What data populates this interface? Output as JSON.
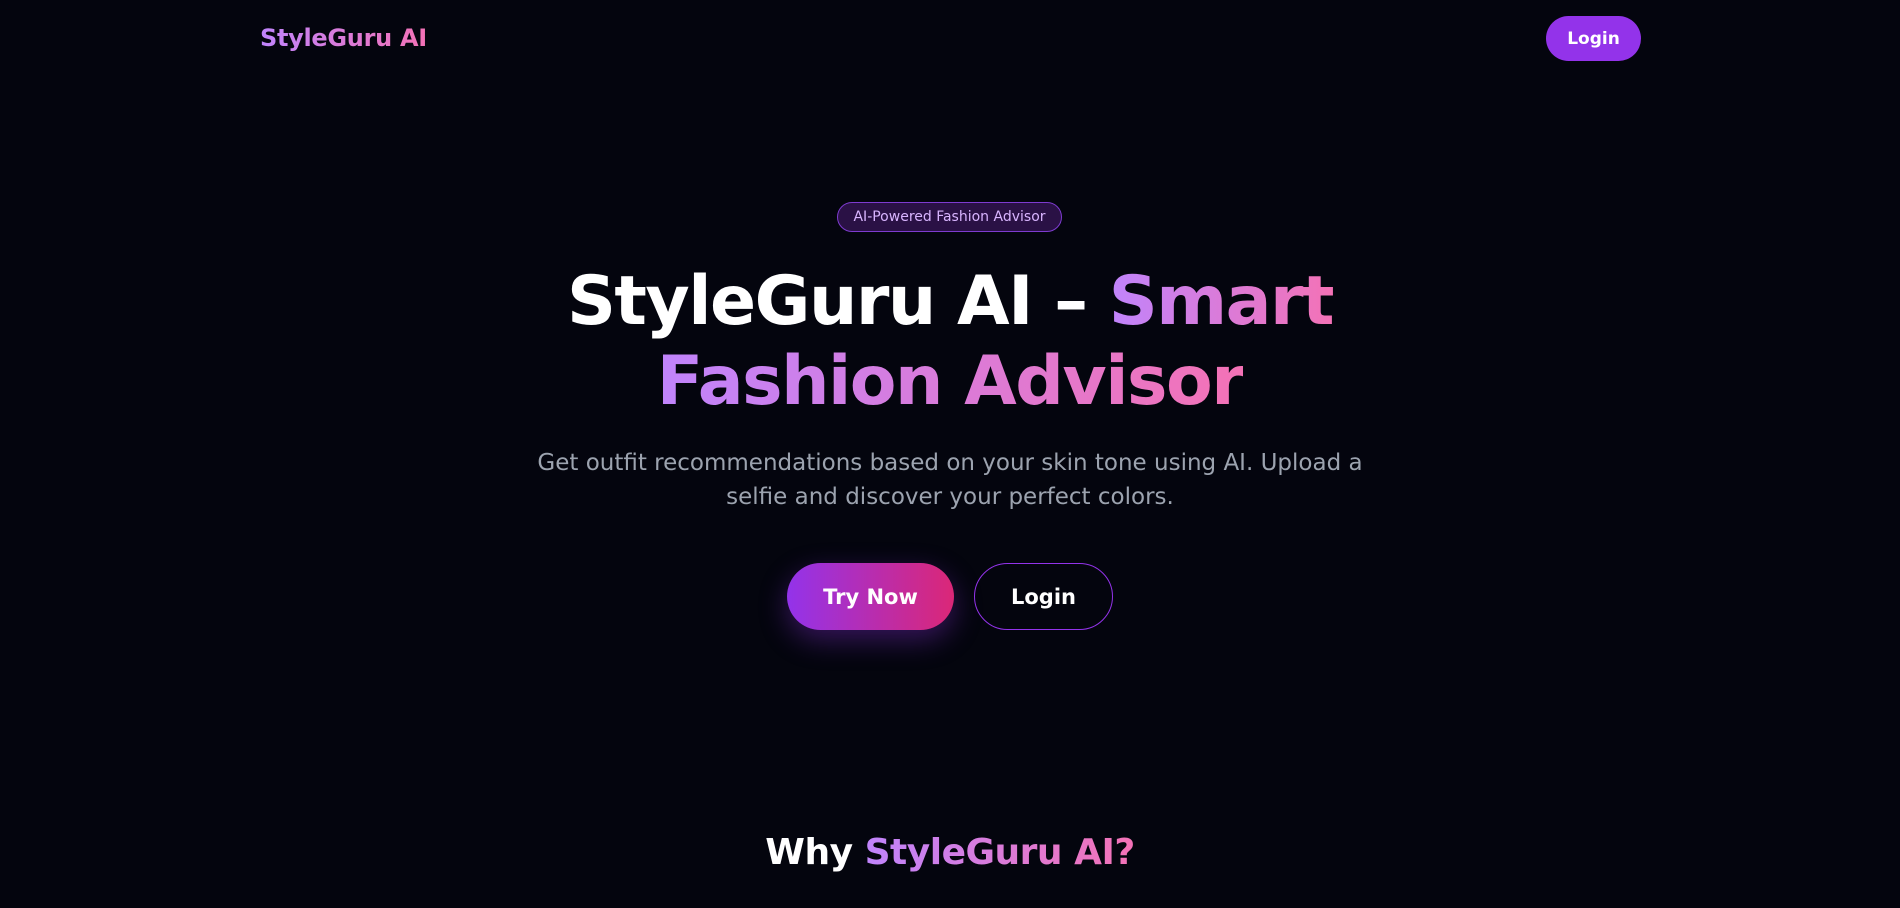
{
  "navbar": {
    "brand": "StyleGuru AI",
    "login_label": "Login"
  },
  "hero": {
    "badge": "AI-Powered Fashion Advisor",
    "headline_plain": "StyleGuru AI – ",
    "headline_accent_1": "Smart",
    "headline_accent_2": "Fashion Advisor",
    "subtitle": "Get outfit recommendations based on your skin tone using AI. Upload a selfie and discover your perfect colors.",
    "try_label": "Try Now",
    "login_label": "Login"
  },
  "why": {
    "prefix": "Why ",
    "accent": "StyleGuru AI?"
  },
  "colors": {
    "background": "#04050e",
    "accent_purple": "#9333ea",
    "gradient_start": "#c084fc",
    "gradient_end": "#f472b6",
    "subtitle_gray": "#9ca3af"
  }
}
